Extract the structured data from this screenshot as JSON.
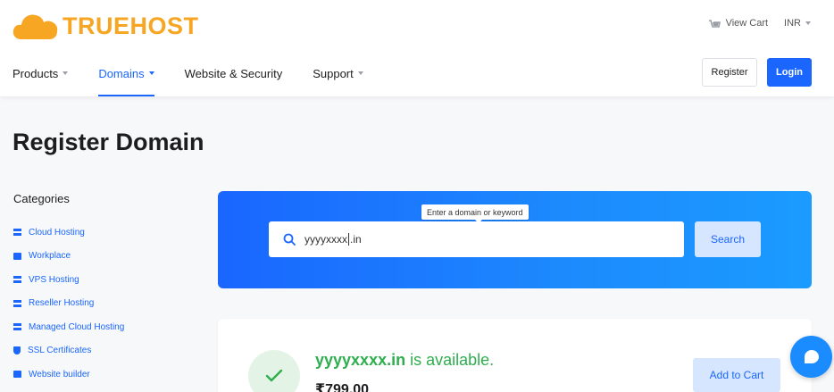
{
  "brand": {
    "name": "TRUEHOST",
    "color": "#f6a623",
    "accent": "#1a66ff"
  },
  "topbar": {
    "cart_label": "View Cart",
    "currency": "INR"
  },
  "nav": [
    {
      "label": "Products",
      "has_dropdown": true,
      "active": false
    },
    {
      "label": "Domains",
      "has_dropdown": true,
      "active": true
    },
    {
      "label": "Website & Security",
      "has_dropdown": false,
      "active": false
    },
    {
      "label": "Support",
      "has_dropdown": true,
      "active": false
    }
  ],
  "auth": {
    "register_label": "Register",
    "login_label": "Login"
  },
  "page": {
    "title": "Register Domain"
  },
  "sidebar": {
    "title": "Categories",
    "items": [
      {
        "label": "Cloud Hosting",
        "icon": "server-icon"
      },
      {
        "label": "Workplace",
        "icon": "box-icon"
      },
      {
        "label": "VPS Hosting",
        "icon": "server-icon"
      },
      {
        "label": "Reseller Hosting",
        "icon": "server-icon"
      },
      {
        "label": "Managed Cloud Hosting",
        "icon": "server-icon"
      },
      {
        "label": "SSL Certificates",
        "icon": "shield-icon"
      },
      {
        "label": "Website builder",
        "icon": "box-icon"
      }
    ]
  },
  "search": {
    "tooltip": "Enter a domain or keyword",
    "value_before_cursor": "yyyyxxxx",
    "value_after_cursor": ".in",
    "button_label": "Search"
  },
  "result": {
    "domain": "yyyyxxxx.in",
    "status_text": " is available.",
    "price": "₹799.00",
    "add_to_cart_label": "Add to Cart",
    "status_color": "#2eae4e"
  }
}
